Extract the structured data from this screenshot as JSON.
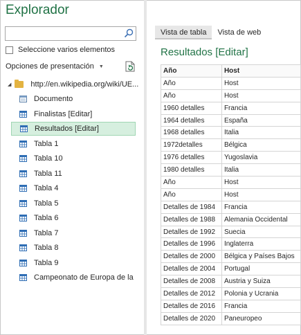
{
  "header": {
    "title": "Explorador"
  },
  "search": {
    "value": "",
    "placeholder": ""
  },
  "options": {
    "select_multiple": "Seleccione varios elementos",
    "view_options": "Opciones de presentación"
  },
  "tree": {
    "root": "http://en.wikipedia.org/wiki/UE...",
    "items": [
      {
        "label": "Documento",
        "icon": "document-icon",
        "selected": false
      },
      {
        "label": "Finalistas [Editar]",
        "icon": "table-icon",
        "selected": false
      },
      {
        "label": "Resultados [Editar]",
        "icon": "table-icon",
        "selected": true
      },
      {
        "label": "Tabla 1",
        "icon": "table-icon",
        "selected": false
      },
      {
        "label": "Tabla 10",
        "icon": "table-icon",
        "selected": false
      },
      {
        "label": "Tabla 11",
        "icon": "table-icon",
        "selected": false
      },
      {
        "label": "Tabla 4",
        "icon": "table-icon",
        "selected": false
      },
      {
        "label": "Tabla 5",
        "icon": "table-icon",
        "selected": false
      },
      {
        "label": "Tabla 6",
        "icon": "table-icon",
        "selected": false
      },
      {
        "label": "Tabla 7",
        "icon": "table-icon",
        "selected": false
      },
      {
        "label": "Tabla 8",
        "icon": "table-icon",
        "selected": false
      },
      {
        "label": "Tabla 9",
        "icon": "table-icon",
        "selected": false
      },
      {
        "label": "Campeonato de Europa de la ...",
        "icon": "table-icon",
        "selected": false
      }
    ]
  },
  "tabs": [
    {
      "label": "Vista de tabla",
      "active": true
    },
    {
      "label": "Vista de web",
      "active": false
    }
  ],
  "preview": {
    "title": "Resultados [Editar]",
    "columns": [
      "Año",
      "Host"
    ],
    "rows": [
      [
        "Año",
        "Host"
      ],
      [
        "Año",
        "Host"
      ],
      [
        "1960 detalles",
        "Francia"
      ],
      [
        "1964 detalles",
        "España"
      ],
      [
        "1968 detalles",
        "Italia"
      ],
      [
        "1972detalles",
        "Bélgica"
      ],
      [
        "1976 detalles",
        "Yugoslavia"
      ],
      [
        "1980 detalles",
        "Italia"
      ],
      [
        "Año",
        "Host"
      ],
      [
        "Año",
        "Host"
      ],
      [
        "Detalles de 1984",
        "Francia"
      ],
      [
        "Detalles de 1988",
        "Alemania Occidental"
      ],
      [
        "Detalles de 1992",
        "Suecia"
      ],
      [
        "Detalles de 1996",
        "Inglaterra"
      ],
      [
        "Detalles de 2000",
        "Bélgica y Países Bajos"
      ],
      [
        "Detalles de 2004",
        "Portugal"
      ],
      [
        "Detalles de 2008",
        "Austria y Suiza"
      ],
      [
        "Detalles de 2012",
        "Polonia y Ucrania"
      ],
      [
        "Detalles de 2016",
        "Francia"
      ],
      [
        "Detalles de 2020",
        "Paneuropeo"
      ]
    ]
  },
  "colors": {
    "accent": "#217346",
    "selection": "#d6efdf",
    "folder": "#e3b341",
    "table_icon": "#2e6db4"
  }
}
